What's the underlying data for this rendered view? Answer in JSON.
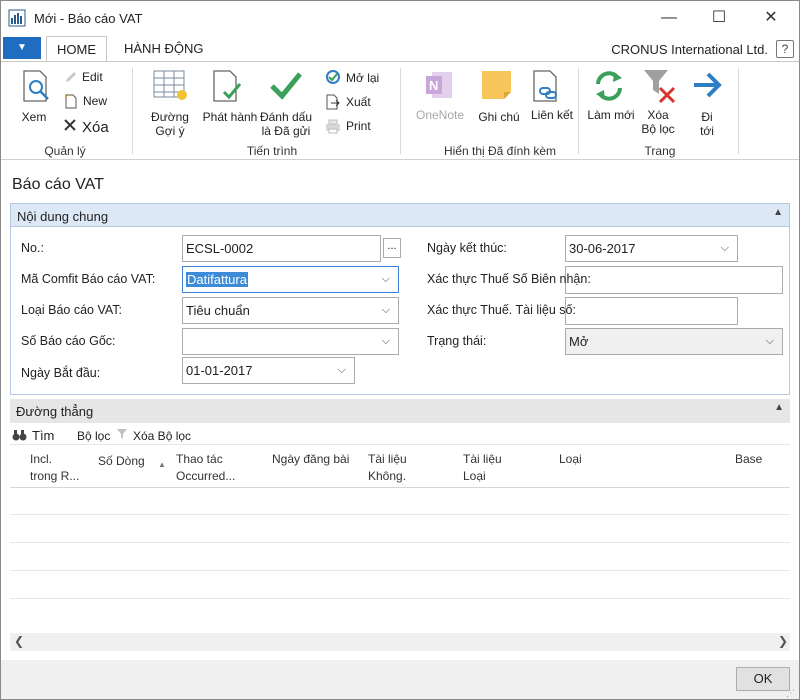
{
  "window": {
    "title": "Mới - Báo cáo VAT",
    "minimize": "—",
    "maximize": "☐",
    "close": "✕"
  },
  "ribbon_tabs": {
    "menu": "▼",
    "home": "HOME",
    "actions": "HÀNH ĐỘNG"
  },
  "company": "CRONUS International Ltd.",
  "help": "?",
  "ribbon": {
    "manage": {
      "label": "Quản lý",
      "view": "Xem",
      "edit": "Edit",
      "new": "New",
      "delete": "Xóa"
    },
    "process": {
      "label": "Tiến trình",
      "suggest_lines": [
        "Đường",
        "Gợi ý"
      ],
      "release": "Phát hành",
      "mark_submitted": [
        "Đánh dấu",
        "là Đã gửi"
      ],
      "reopen": "Mở lại",
      "export": "Xuất",
      "print": "Print"
    },
    "attachments": {
      "label": "Hiển thị Đã đính kèm",
      "onenote": "OneNote",
      "notes": "Ghi chú",
      "links": "Liên kết"
    },
    "page": {
      "label": "Trang",
      "refresh": "Làm mới",
      "clear_filter": [
        "Xóa",
        "Bộ lọc"
      ],
      "go_to": [
        "Đi",
        "tới"
      ]
    }
  },
  "page_title": "Báo cáo VAT",
  "general": {
    "header": "Nội dung chung",
    "fields": {
      "no_label": "No.:",
      "no_value": "ECSL-0002",
      "assist": "...",
      "config_label": "Mã Comfit Báo cáo VAT:",
      "config_value": "Datifattura",
      "type_label": "Loại Báo cáo VAT:",
      "type_value": "Tiêu chuẩn",
      "original_label": "Số Báo cáo Gốc:",
      "original_value": "",
      "start_label": "Ngày Bắt đầu:",
      "start_value": "01-01-2017",
      "end_label": "Ngày kết thúc:",
      "end_value": "30-06-2017",
      "receipt_label": "Xác thực Thuế Số Biên nhận:",
      "receipt_value": "",
      "doc_label": "Xác thực Thuế. Tài liệu số:",
      "doc_value": "",
      "status_label": "Trạng thái:",
      "status_value": "Mở"
    }
  },
  "lines": {
    "header": "Đường thẳng",
    "toolbar": {
      "find": "Tìm",
      "filter": "Bộ lọc",
      "clear_filter": "Xóa Bộ lọc"
    },
    "columns": [
      [
        "Incl.",
        "trong R..."
      ],
      [
        "Số Dòng",
        ""
      ],
      [
        "Thao tác",
        "Occurred..."
      ],
      [
        "Ngày đăng bài",
        ""
      ],
      [
        "Tài liệu",
        "Không."
      ],
      [
        "Tài liệu",
        "Loại"
      ],
      [
        "Loại",
        ""
      ],
      [
        "Base",
        ""
      ]
    ]
  },
  "footer": {
    "ok": "OK"
  },
  "colors": {
    "accent": "#1e6dc0",
    "section_header": "#dde8f6",
    "icon_green": "#3aa05a",
    "icon_blue": "#2f7ec4",
    "onenote": "#b079c4"
  }
}
